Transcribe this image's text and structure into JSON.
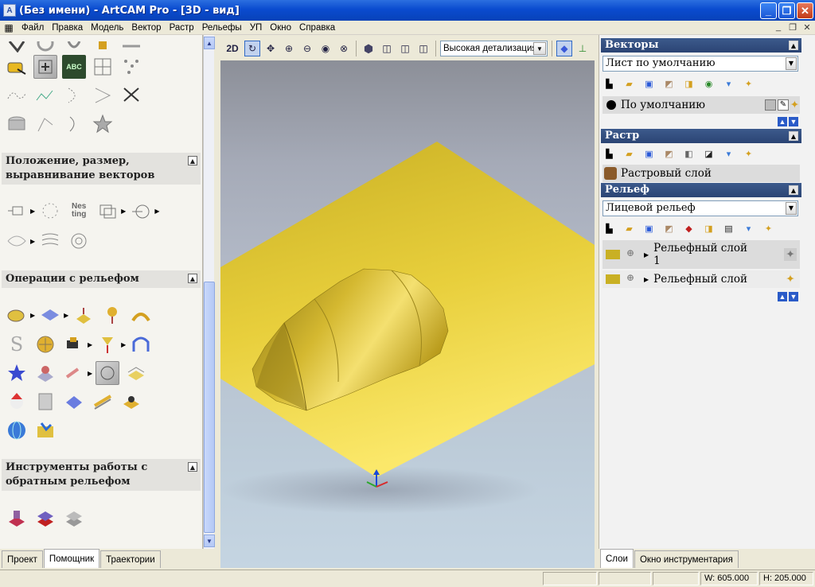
{
  "window": {
    "title": "(Без имени) - ArtCAM Pro - [3D - вид]",
    "app_icon": "artcam-icon"
  },
  "menu": [
    "Файл",
    "Правка",
    "Модель",
    "Вектор",
    "Растр",
    "Рельефы",
    "УП",
    "Окно",
    "Справка"
  ],
  "left_panel": {
    "sections": [
      {
        "title": "Положение, размер, выравнивание векторов"
      },
      {
        "title": "Операции с рельефом"
      },
      {
        "title": "Инструменты работы с обратным рельефом"
      }
    ],
    "nesting_label": "Nes ting"
  },
  "left_tabs": [
    "Проект",
    "Помощник",
    "Траектории"
  ],
  "view_toolbar": {
    "mode_label": "2D",
    "detail_select": "Высокая детализация"
  },
  "vectors": {
    "header": "Векторы",
    "sheet_select": "Лист по умолчанию",
    "layer": "По умолчанию"
  },
  "raster": {
    "header": "Растр",
    "layer": "Растровый слой"
  },
  "relief": {
    "header": "Рельеф",
    "select": "Лицевой рельеф",
    "layers": [
      "Рельефный слой 1",
      "Рельефный слой"
    ]
  },
  "right_tabs": [
    "Слои",
    "Окно инструментария"
  ],
  "status": {
    "width": "W: 605.000",
    "height": "H: 205.000"
  },
  "colors": {
    "title_bar": "#0a4bcf",
    "panel_header": "#2b4474",
    "relief_plane": "#e8cf3c",
    "relief_body": "#cdb032"
  }
}
